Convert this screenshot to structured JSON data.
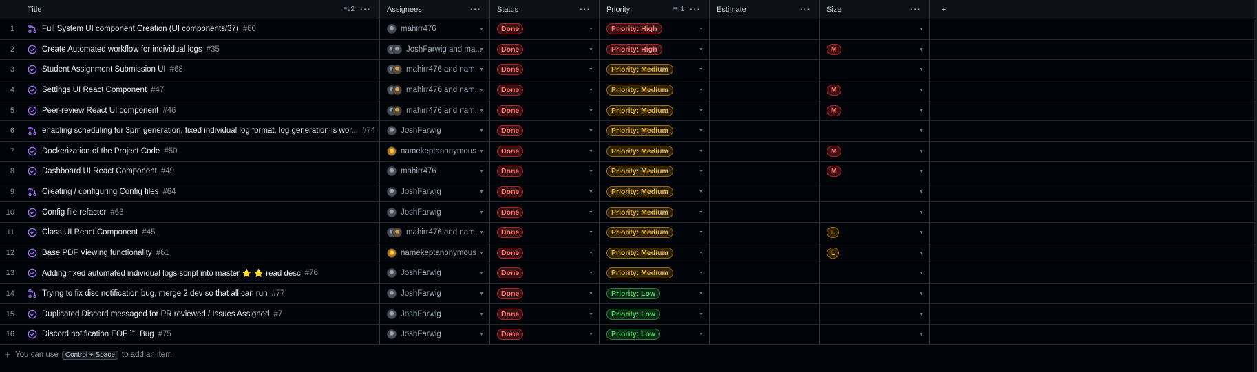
{
  "headers": {
    "title": "Title",
    "assignees": "Assignees",
    "status": "Status",
    "priority": "Priority",
    "estimate": "Estimate",
    "size": "Size",
    "title_sort": "2",
    "priority_sort": "1"
  },
  "rows": [
    {
      "n": "1",
      "type": "pr",
      "title": "Full System UI component Creation (UI components/37)",
      "num": "#60",
      "avatars": [
        "gray"
      ],
      "assignee": "mahirr476",
      "status": "Done",
      "priority": "Priority: High",
      "prio_level": "high",
      "size": ""
    },
    {
      "n": "2",
      "type": "issue",
      "title": "Create Automated workflow for individual logs",
      "num": "#35",
      "avatars": [
        "gray",
        "gray"
      ],
      "assignee": "JoshFarwig and ma...",
      "status": "Done",
      "priority": "Priority: High",
      "prio_level": "high",
      "size": "M"
    },
    {
      "n": "3",
      "type": "issue",
      "title": "Student Assignment Submission UI",
      "num": "#68",
      "avatars": [
        "gray",
        "brown"
      ],
      "assignee": "mahirr476 and nam...",
      "status": "Done",
      "priority": "Priority: Medium",
      "prio_level": "medium",
      "size": ""
    },
    {
      "n": "4",
      "type": "issue",
      "title": "Settings UI React Component",
      "num": "#47",
      "avatars": [
        "gray",
        "brown"
      ],
      "assignee": "mahirr476 and nam...",
      "status": "Done",
      "priority": "Priority: Medium",
      "prio_level": "medium",
      "size": "M"
    },
    {
      "n": "5",
      "type": "issue",
      "title": "Peer-review React UI component",
      "num": "#46",
      "avatars": [
        "gray",
        "brown"
      ],
      "assignee": "mahirr476 and nam...",
      "status": "Done",
      "priority": "Priority: Medium",
      "prio_level": "medium",
      "size": "M"
    },
    {
      "n": "6",
      "type": "pr",
      "title": "enabling scheduling for 3pm generation, fixed individual log format, log generation is wor...",
      "num": "#74",
      "avatars": [
        "gray"
      ],
      "assignee": "JoshFarwig",
      "status": "Done",
      "priority": "Priority: Medium",
      "prio_level": "medium",
      "size": ""
    },
    {
      "n": "7",
      "type": "issue",
      "title": "Dockerization of the Project Code",
      "num": "#50",
      "avatars": [
        "orange"
      ],
      "assignee": "namekeptanonymous",
      "status": "Done",
      "priority": "Priority: Medium",
      "prio_level": "medium",
      "size": "M"
    },
    {
      "n": "8",
      "type": "issue",
      "title": "Dashboard UI React Component",
      "num": "#49",
      "avatars": [
        "gray"
      ],
      "assignee": "mahirr476",
      "status": "Done",
      "priority": "Priority: Medium",
      "prio_level": "medium",
      "size": "M"
    },
    {
      "n": "9",
      "type": "pr",
      "title": "Creating / configuring Config files",
      "num": "#64",
      "avatars": [
        "gray"
      ],
      "assignee": "JoshFarwig",
      "status": "Done",
      "priority": "Priority: Medium",
      "prio_level": "medium",
      "size": ""
    },
    {
      "n": "10",
      "type": "issue",
      "title": "Config file refactor",
      "num": "#63",
      "avatars": [
        "gray"
      ],
      "assignee": "JoshFarwig",
      "status": "Done",
      "priority": "Priority: Medium",
      "prio_level": "medium",
      "size": ""
    },
    {
      "n": "11",
      "type": "issue",
      "title": "Class UI React Component",
      "num": "#45",
      "avatars": [
        "gray",
        "brown"
      ],
      "assignee": "mahirr476 and nam...",
      "status": "Done",
      "priority": "Priority: Medium",
      "prio_level": "medium",
      "size": "L"
    },
    {
      "n": "12",
      "type": "issue",
      "title": "Base PDF Viewing functionality",
      "num": "#61",
      "avatars": [
        "orange"
      ],
      "assignee": "namekeptanonymous",
      "status": "Done",
      "priority": "Priority: Medium",
      "prio_level": "medium",
      "size": "L"
    },
    {
      "n": "13",
      "type": "issue",
      "title": "Adding fixed automated individual logs script into master ⭐ ⭐ read desc",
      "num": "#76",
      "avatars": [
        "gray"
      ],
      "assignee": "JoshFarwig",
      "status": "Done",
      "priority": "Priority: Medium",
      "prio_level": "medium",
      "size": ""
    },
    {
      "n": "14",
      "type": "pr",
      "title": "Trying to fix disc notification bug, merge 2 dev so that all can run",
      "num": "#77",
      "avatars": [
        "gray"
      ],
      "assignee": "JoshFarwig",
      "status": "Done",
      "priority": "Priority: Low",
      "prio_level": "low",
      "size": ""
    },
    {
      "n": "15",
      "type": "issue",
      "title": "Duplicated Discord messaged for PR reviewed / Issues Assigned",
      "num": "#7",
      "avatars": [
        "gray"
      ],
      "assignee": "JoshFarwig",
      "status": "Done",
      "priority": "Priority: Low",
      "prio_level": "low",
      "size": ""
    },
    {
      "n": "16",
      "type": "issue",
      "title": "Discord notification EOF `\"` Bug",
      "num": "#75",
      "avatars": [
        "gray"
      ],
      "assignee": "JoshFarwig",
      "status": "Done",
      "priority": "Priority: Low",
      "prio_level": "low",
      "size": ""
    }
  ],
  "footer": {
    "prefix": "You can use",
    "shortcut": "Control + Space",
    "suffix": "to add an item"
  },
  "icons": {
    "pr": "pull-request-icon",
    "issue": "closed-issue-icon",
    "menu": "kebab-menu-icon",
    "add": "plus-icon"
  },
  "colors": {
    "background": "#010409",
    "done": "#ff7b72",
    "high": "#ff7b72",
    "medium": "#e3b341",
    "low": "#56d364",
    "icon_purple": "#a371f7"
  }
}
